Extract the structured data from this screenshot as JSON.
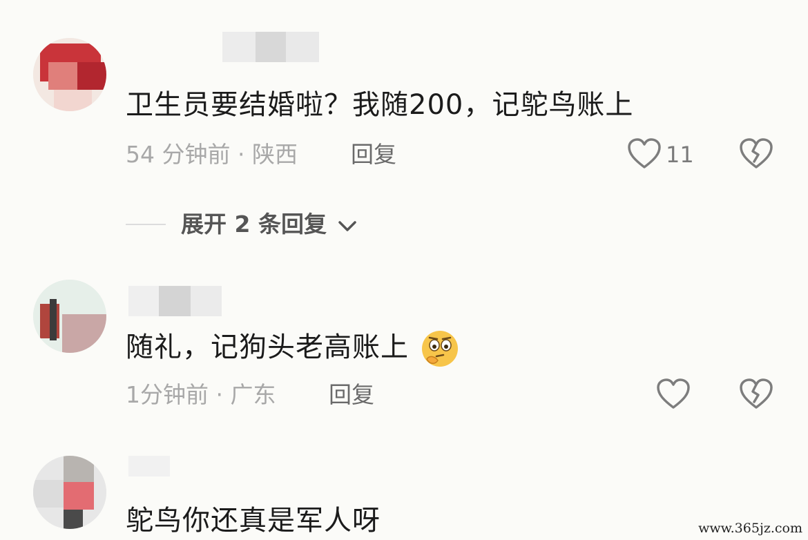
{
  "comments": [
    {
      "text": "卫生员要结婚啦？我随200，记鸵鸟账上",
      "time_location": "54 分钟前 · 陕西",
      "reply_label": "回复",
      "like_count": "11"
    },
    {
      "text": "随礼，记狗头老高账上",
      "time_location": "1分钟前 · 广东",
      "reply_label": "回复",
      "like_count": ""
    },
    {
      "text": "鸵鸟你还真是军人呀"
    }
  ],
  "expand_replies_label": "展开 2 条回复",
  "icons": {
    "like": "heart-outline-icon",
    "dislike": "broken-heart-icon",
    "expand": "chevron-down-icon",
    "emoji": "thinking-face-emoji"
  },
  "colors": {
    "background": "#fbfbf8",
    "meta_text": "#a8a8a8",
    "reply_text": "#6a6a6a"
  },
  "watermark": "www.365jz.com"
}
